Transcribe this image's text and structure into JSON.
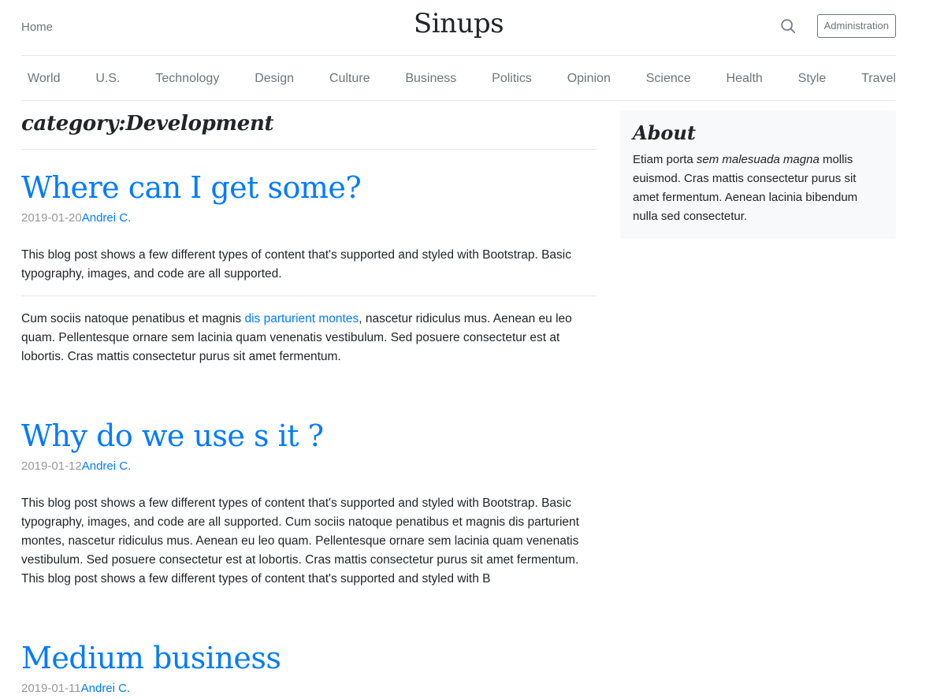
{
  "header": {
    "home": "Home",
    "brand": "Sinups",
    "admin_button": "Administration"
  },
  "nav": [
    "World",
    "U.S.",
    "Technology",
    "Design",
    "Culture",
    "Business",
    "Politics",
    "Opinion",
    "Science",
    "Health",
    "Style",
    "Travel"
  ],
  "main": {
    "category_title": "category:Development",
    "posts": [
      {
        "title": "Where can I get some?",
        "date": "2019-01-20",
        "author": "Andrei C.",
        "excerpt": "This blog post shows a few different types of content that's supported and styled with Bootstrap. Basic typography, images, and code are all supported.",
        "body_before_link": "Cum sociis natoque penatibus et magnis ",
        "body_link": "dis parturient montes",
        "body_after_link": ", nascetur ridiculus mus. Aenean eu leo quam. Pellentesque ornare sem lacinia quam venenatis vestibulum. Sed posuere consectetur est at lobortis. Cras mattis consectetur purus sit amet fermentum."
      },
      {
        "title": "Why do we use s it ?",
        "date": "2019-01-12",
        "author": "Andrei C.",
        "excerpt": "This blog post shows a few different types of content that's supported and styled with Bootstrap. Basic typography, images, and code are all supported. Cum sociis natoque penatibus et magnis dis parturient montes, nascetur ridiculus mus. Aenean eu leo quam. Pellentesque ornare sem lacinia quam venenatis vestibulum. Sed posuere consectetur est at lobortis. Cras mattis consectetur purus sit amet fermentum. This blog post shows a few different types of content that's supported and styled with B"
      },
      {
        "title": "Medium business",
        "date": "2019-01-11",
        "author": "Andrei C."
      }
    ]
  },
  "sidebar": {
    "title": "About",
    "text_before": "Etiam porta ",
    "text_em": "sem malesuada magna",
    "text_after": " mollis euismod. Cras mattis consectetur purus sit amet fermentum. Aenean lacinia bibendum nulla sed consectetur."
  }
}
